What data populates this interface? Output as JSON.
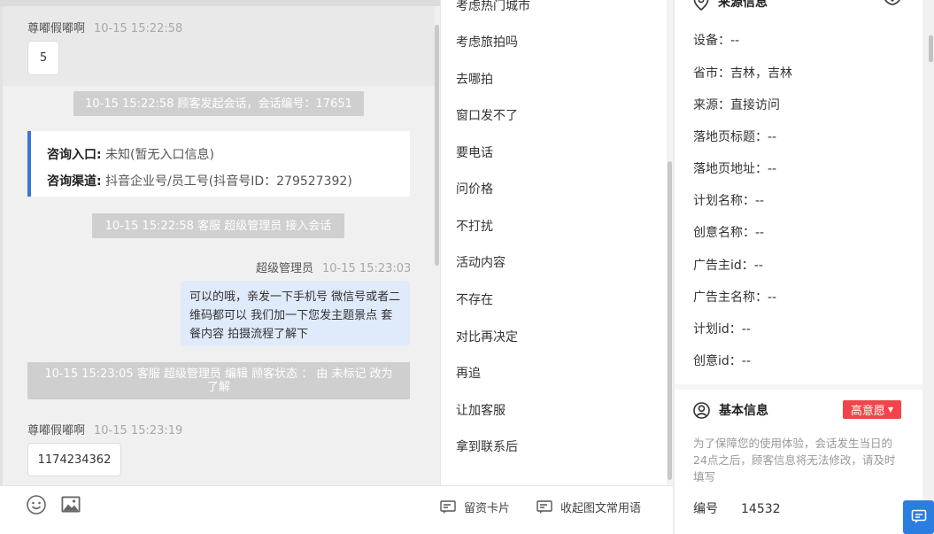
{
  "chat": {
    "messages": [
      {
        "sender": "尊嘟假嘟啊",
        "time": "10-15 15:22:58",
        "text": "5"
      },
      {
        "sender": "超级管理员",
        "time": "10-15 15:23:03",
        "text": "可以的哦，亲发一下手机号 微信号或者二维码都可以 我们加一下您发主题景点 套餐内容 拍摄流程了解下"
      },
      {
        "sender": "尊嘟假嘟啊",
        "time": "10-15 15:23:19",
        "text": "1174234362"
      }
    ],
    "system": [
      "10-15 15:22:58 顾客发起会话，会话编号：17651",
      "10-15 15:22:58 客服 超级管理员 接入会话",
      "10-15 15:23:05 客服 超级管理员 编辑 顾客状态 ： 由 未标记 改为 了解"
    ],
    "info_card": {
      "entry_label": "咨询入口:",
      "entry_value": "未知(暂无入口信息)",
      "channel_label": "咨询渠道:",
      "channel_value": "抖音企业号/员工号(抖音号ID：279527392)"
    }
  },
  "toolbar": {
    "emoji_icon": "smile-icon",
    "image_icon": "image-icon",
    "card_label": "留资卡片",
    "collapse_label": "收起图文常用语"
  },
  "quick_replies": [
    "考虑热门城市",
    "考虑旅拍吗",
    "去哪拍",
    "窗口发不了",
    "要电话",
    "问价格",
    "不打扰",
    "活动内容",
    "不存在",
    "对比再决定",
    "再追",
    "让加客服",
    "拿到联系后"
  ],
  "source_info": {
    "title": "来源信息",
    "fields": [
      "设备：--",
      "省市：吉林，吉林",
      "来源：直接访问",
      "落地页标题：--",
      "落地页地址：--",
      "计划名称：--",
      "创意名称：--",
      "广告主id：--",
      "广告主名称：--",
      "计划id：--",
      "创意id：--"
    ]
  },
  "basic_info": {
    "title": "基本信息",
    "intent_tag": "高意愿",
    "notice": "为了保障您的使用体验，会话发生当日的24点之后，顾客信息将无法修改，请及时填写",
    "number_label": "编号",
    "number_value": "14532"
  },
  "colors": {
    "accent": "#3a76d6",
    "tag": "#f0454a",
    "outgoing_bubble": "#dfeafb",
    "system_notice": "#cfcfcf"
  }
}
